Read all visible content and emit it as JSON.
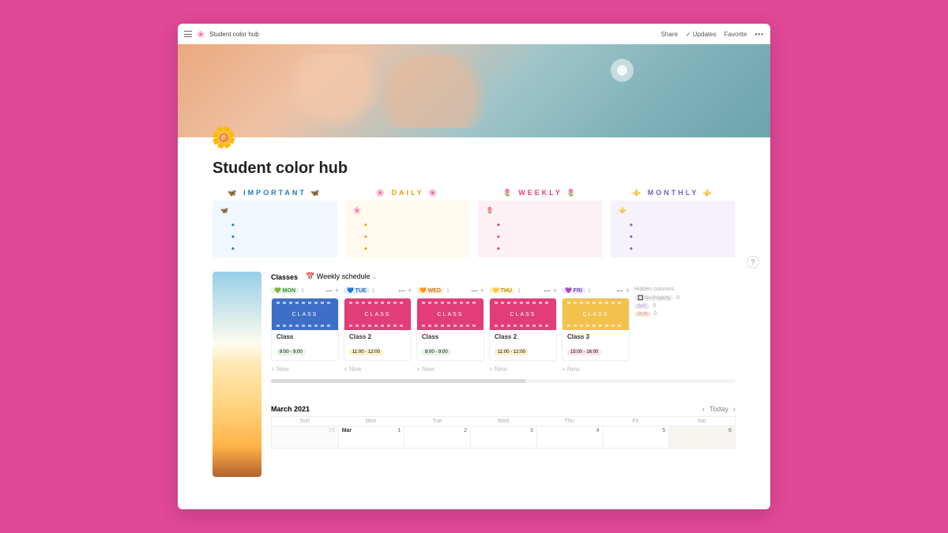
{
  "topbar": {
    "crumb_icon": "🌸",
    "crumb_title": "Student color hub",
    "share": "Share",
    "updates": "Updates",
    "favorite": "Favorite"
  },
  "page": {
    "emoji": "🌼",
    "title": "Student color hub"
  },
  "categories": [
    {
      "key": "important",
      "icon": "🦋",
      "label": "IMPORTANT",
      "lead": "🦋"
    },
    {
      "key": "daily",
      "icon": "🌸",
      "label": "DAILY",
      "lead": "🌸"
    },
    {
      "key": "weekly",
      "icon": "🌷",
      "label": "WEEKLY",
      "lead": "🌷"
    },
    {
      "key": "monthly",
      "icon": "⚜️",
      "label": "MONTHLY",
      "lead": "⚜️"
    }
  ],
  "help": "?",
  "classes": {
    "title": "Classes",
    "view_icon": "📅",
    "view_label": "Weekly schedule",
    "columns": [
      {
        "icon": "💚",
        "label": "MON",
        "count": "1",
        "badge_bg": "#e6f3e6",
        "badge_fg": "#3a8a3a",
        "hero": "blue",
        "class_name": "Class",
        "time": "8:00 - 9:00",
        "time_bg": "#e6f3e6"
      },
      {
        "icon": "💙",
        "label": "TUE",
        "count": "1",
        "badge_bg": "#e3eefb",
        "badge_fg": "#2a6db8",
        "hero": "pink",
        "class_name": "Class 2",
        "time": "11:00 - 12:00",
        "time_bg": "#fff0cc"
      },
      {
        "icon": "🧡",
        "label": "WED",
        "count": "1",
        "badge_bg": "#fdeedd",
        "badge_fg": "#c47a1f",
        "hero": "pink",
        "class_name": "Class",
        "time": "8:00 - 9:00",
        "time_bg": "#e6f3e6"
      },
      {
        "icon": "💛",
        "label": "THU",
        "count": "1",
        "badge_bg": "#fff5d6",
        "badge_fg": "#b38e1a",
        "hero": "pink",
        "class_name": "Class 2",
        "time": "11:00 - 12:00",
        "time_bg": "#fff0cc"
      },
      {
        "icon": "💜",
        "label": "FRI",
        "count": "1",
        "badge_bg": "#efe8fa",
        "badge_fg": "#6b4fb3",
        "hero": "yellow",
        "class_name": "Class 3",
        "time": "15:00 - 16:00",
        "time_bg": "#fde4ea"
      }
    ],
    "new_label": "New",
    "hidden": {
      "title": "Hidden columns",
      "items": [
        {
          "icon": "🔲",
          "label": "No Property",
          "count": "0",
          "bg": "#f1f1ef"
        },
        {
          "icon": "",
          "label": "SAT",
          "count": "0",
          "bg": "#f1e4fa"
        },
        {
          "icon": "",
          "label": "SUN",
          "count": "0",
          "bg": "#fde4d6"
        }
      ]
    }
  },
  "calendar": {
    "title": "March 2021",
    "today": "Today",
    "days": [
      "Sun",
      "Mon",
      "Tue",
      "Wed",
      "Thu",
      "Fri",
      "Sat"
    ],
    "row": [
      {
        "label": "28",
        "dim": true
      },
      {
        "label": "1",
        "month": "Mar"
      },
      {
        "label": "2"
      },
      {
        "label": "3"
      },
      {
        "label": "4"
      },
      {
        "label": "5"
      },
      {
        "label": "6",
        "today": true
      }
    ]
  }
}
